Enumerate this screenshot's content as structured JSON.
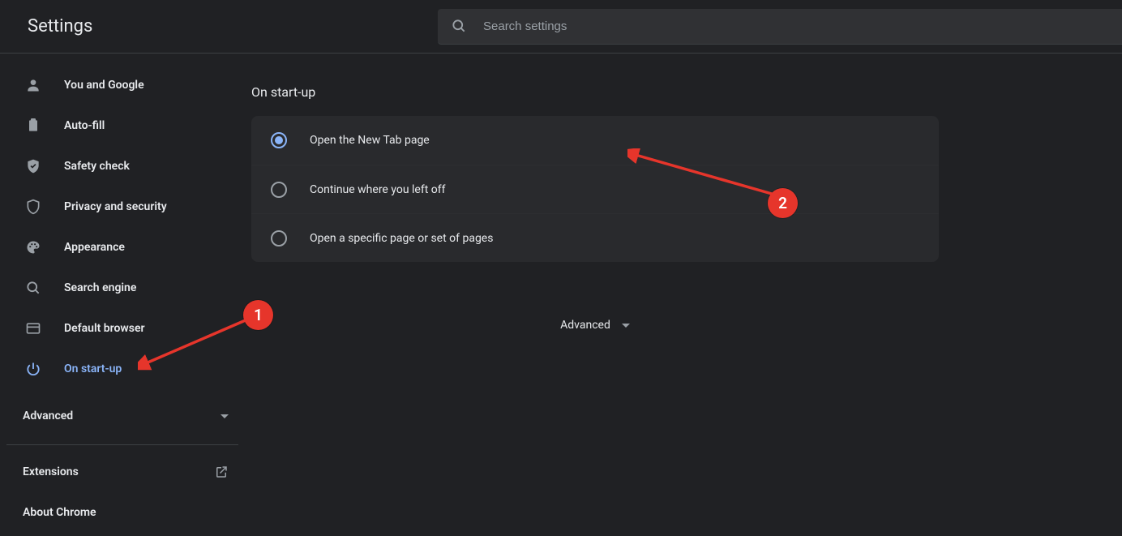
{
  "header": {
    "title": "Settings"
  },
  "search": {
    "placeholder": "Search settings"
  },
  "sidebar": {
    "items": [
      {
        "label": "You and Google"
      },
      {
        "label": "Auto-fill"
      },
      {
        "label": "Safety check"
      },
      {
        "label": "Privacy and security"
      },
      {
        "label": "Appearance"
      },
      {
        "label": "Search engine"
      },
      {
        "label": "Default browser"
      },
      {
        "label": "On start-up"
      }
    ],
    "advanced": "Advanced",
    "extensions": "Extensions",
    "about": "About Chrome"
  },
  "main": {
    "section_title": "On start-up",
    "options": [
      {
        "label": "Open the New Tab page"
      },
      {
        "label": "Continue where you left off"
      },
      {
        "label": "Open a specific page or set of pages"
      }
    ],
    "advanced": "Advanced"
  },
  "annotations": {
    "one": "1",
    "two": "2"
  }
}
